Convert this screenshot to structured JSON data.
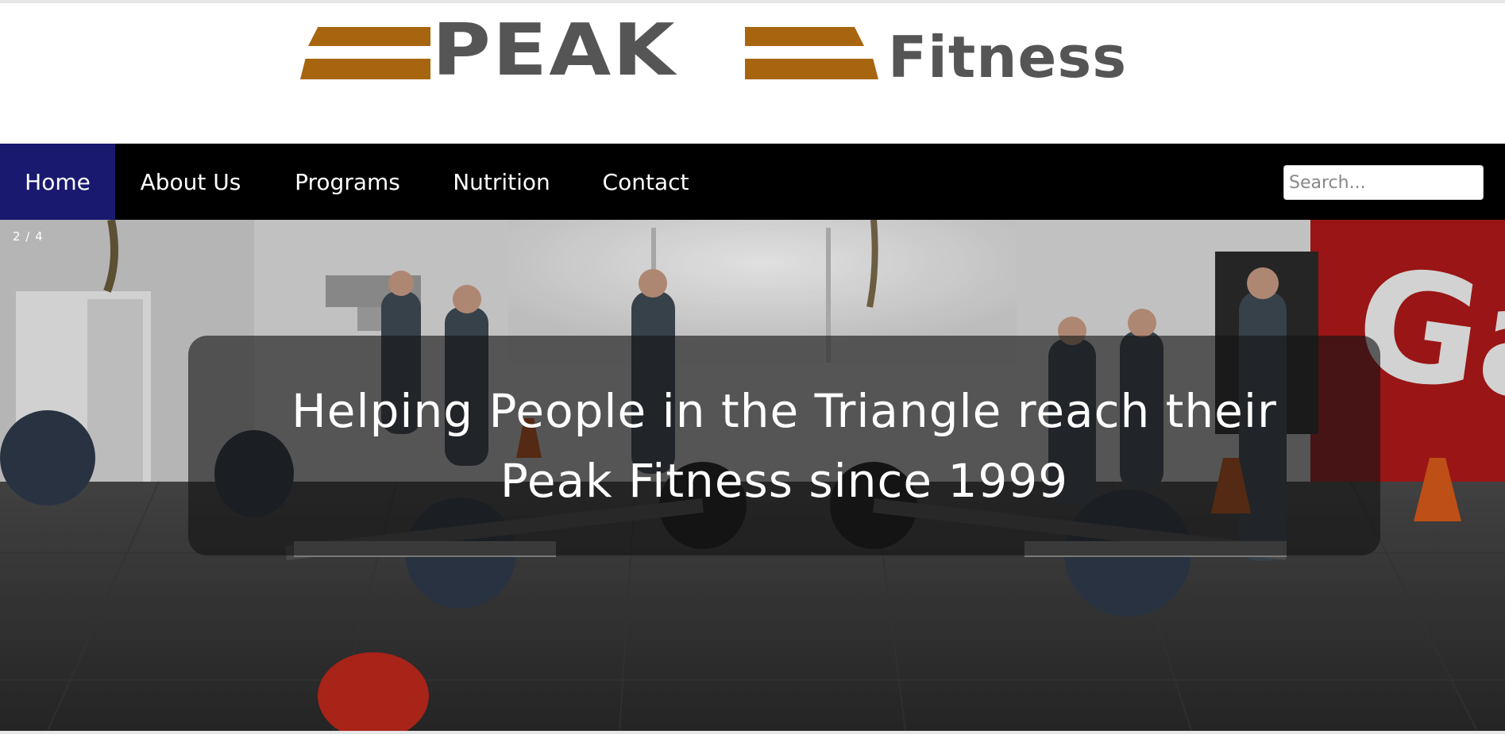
{
  "logo": {
    "word_peak": "PEAK",
    "word_fitness": "Fitness",
    "colors": {
      "bars": "#a8650f",
      "text": "#555555"
    }
  },
  "nav": {
    "items": [
      {
        "label": "Home",
        "active": true
      },
      {
        "label": "About Us",
        "active": false
      },
      {
        "label": "Programs",
        "active": false
      },
      {
        "label": "Nutrition",
        "active": false
      },
      {
        "label": "Contact",
        "active": false
      }
    ],
    "colors": {
      "background": "#000000",
      "active": "#191970",
      "text": "#ffffff"
    }
  },
  "search": {
    "placeholder": "Search...",
    "value": ""
  },
  "hero": {
    "slide_counter": "2 / 4",
    "caption": "Helping People in the Triangle reach their Peak Fitness since 1999",
    "scene_sign_text": "Ga"
  }
}
